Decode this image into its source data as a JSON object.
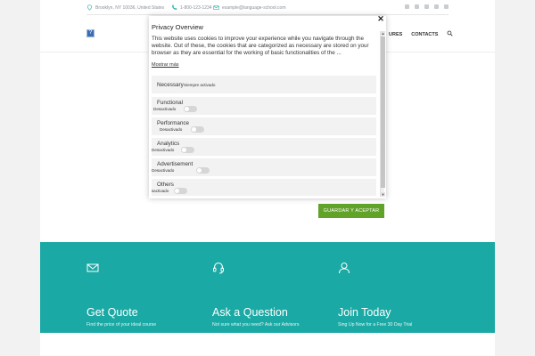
{
  "topbar": {
    "address": "Brooklyn, NY 10036, United States",
    "phone": "1-800-123-1234",
    "email": "example@language-school.com"
  },
  "nav": {
    "items": [
      "URES",
      "CONTACTS"
    ]
  },
  "cookie_modal": {
    "title": "Privacy Overview",
    "description": "This website uses cookies to improve your experience while you navigate through the website. Out of these, the cookies that are categorized as necessary are stored on your browser as they are essential for the working of basic functionalities of the ...",
    "show_more": "Mostrar más",
    "close": "✕",
    "categories": [
      {
        "name": "Necessary",
        "state": "Siempre activado"
      },
      {
        "name": "Functional",
        "state": "Desactivado"
      },
      {
        "name": "Performance",
        "state": "Desactivado"
      },
      {
        "name": "Analytics",
        "state": "Desactivado"
      },
      {
        "name": "Advertisement",
        "state": "Desactivado"
      },
      {
        "name": "Others",
        "state": "Desactivado"
      }
    ],
    "save_button": "GUARDAR Y ACEPTAR"
  },
  "features": [
    {
      "icon": "envelope-icon",
      "title": "Get Quote",
      "subtitle": "Find the price of your ideal course"
    },
    {
      "icon": "headset-icon",
      "title": "Ask a Question",
      "subtitle": "Not sure what you need? Ask our Advisors"
    },
    {
      "icon": "user-icon",
      "title": "Join Today",
      "subtitle": "Sing Up Now for a Free 30 Day Trial"
    }
  ],
  "colors": {
    "teal": "#1aa9a4",
    "accept_green": "#61a229",
    "logo_blue": "#3b6fb3"
  }
}
